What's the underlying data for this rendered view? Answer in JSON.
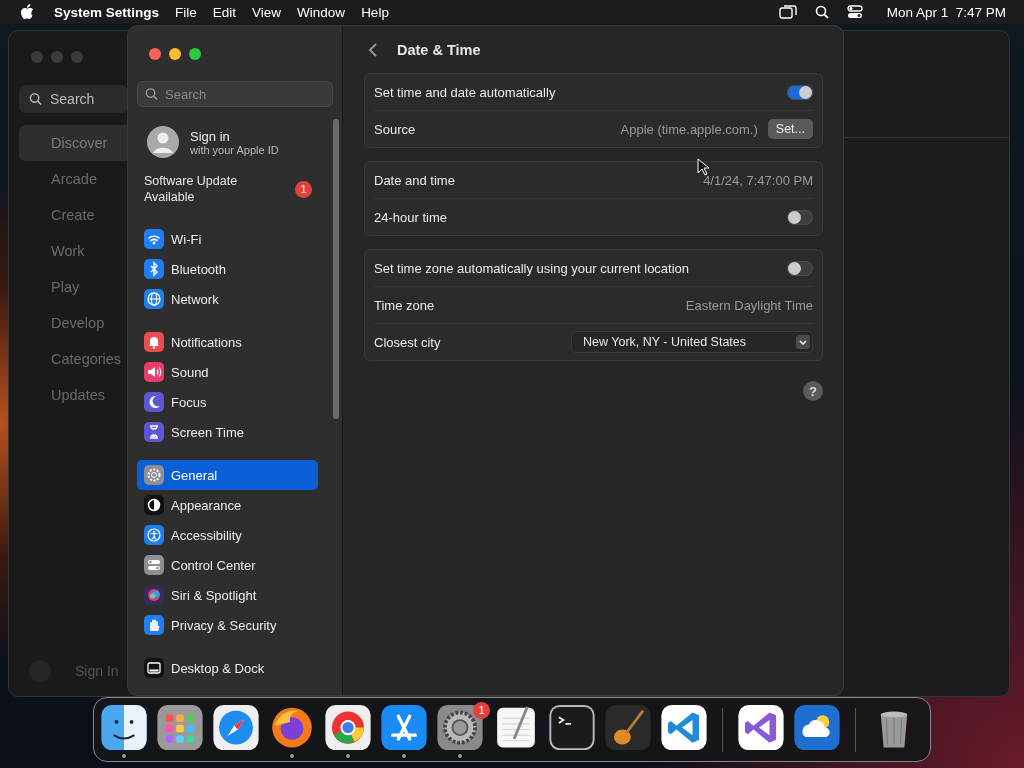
{
  "menubar": {
    "app_name": "System Settings",
    "menus": [
      "File",
      "Edit",
      "View",
      "Window",
      "Help"
    ],
    "clock": "Mon Apr 1  7:47 PM"
  },
  "background_window": {
    "search_placeholder": "Search",
    "items": [
      {
        "label": "Discover",
        "selected": true
      },
      {
        "label": "Arcade",
        "selected": false
      },
      {
        "label": "Create",
        "selected": false
      },
      {
        "label": "Work",
        "selected": false
      },
      {
        "label": "Play",
        "selected": false
      },
      {
        "label": "Develop",
        "selected": false
      },
      {
        "label": "Categories",
        "selected": false
      },
      {
        "label": "Updates",
        "selected": false
      }
    ],
    "sign_in": "Sign In"
  },
  "settings": {
    "sidebar": {
      "search_placeholder": "Search",
      "account": {
        "title": "Sign in",
        "subtitle": "with your Apple ID"
      },
      "update": {
        "label": "Software Update Available",
        "badge": "1"
      },
      "groups": [
        [
          {
            "label": "Wi-Fi",
            "kind": "wifi",
            "selected": false
          },
          {
            "label": "Bluetooth",
            "kind": "bluetooth",
            "selected": false
          },
          {
            "label": "Network",
            "kind": "network",
            "selected": false
          }
        ],
        [
          {
            "label": "Notifications",
            "kind": "notifications",
            "selected": false
          },
          {
            "label": "Sound",
            "kind": "sound",
            "selected": false
          },
          {
            "label": "Focus",
            "kind": "focus",
            "selected": false
          },
          {
            "label": "Screen Time",
            "kind": "screentime",
            "selected": false
          }
        ],
        [
          {
            "label": "General",
            "kind": "general",
            "selected": true
          },
          {
            "label": "Appearance",
            "kind": "appearance",
            "selected": false
          },
          {
            "label": "Accessibility",
            "kind": "accessibility",
            "selected": false
          },
          {
            "label": "Control Center",
            "kind": "controlcenter",
            "selected": false
          },
          {
            "label": "Siri & Spotlight",
            "kind": "siri",
            "selected": false
          },
          {
            "label": "Privacy & Security",
            "kind": "privacy",
            "selected": false
          }
        ],
        [
          {
            "label": "Desktop & Dock",
            "kind": "desktop",
            "selected": false
          }
        ]
      ]
    },
    "content": {
      "title": "Date & Time",
      "groups": [
        [
          {
            "kind": "toggle",
            "label": "Set time and date automatically",
            "on": true
          },
          {
            "kind": "button",
            "label": "Source",
            "value": "Apple (time.apple.com.)",
            "button": "Set..."
          }
        ],
        [
          {
            "kind": "value",
            "label": "Date and time",
            "value": "4/1/24, 7:47:00 PM"
          },
          {
            "kind": "toggle",
            "label": "24-hour time",
            "on": false
          }
        ],
        [
          {
            "kind": "toggle",
            "label": "Set time zone automatically using your current location",
            "on": false
          },
          {
            "kind": "value",
            "label": "Time zone",
            "value": "Eastern Daylight Time"
          },
          {
            "kind": "dropdown",
            "label": "Closest city",
            "value": "New York, NY - United States"
          }
        ]
      ],
      "help": "?"
    }
  },
  "dock": {
    "items": [
      {
        "kind": "finder",
        "running": true
      },
      {
        "kind": "launchpad",
        "running": false
      },
      {
        "kind": "safari",
        "running": false
      },
      {
        "kind": "firefox",
        "running": true
      },
      {
        "kind": "chrome",
        "running": true
      },
      {
        "kind": "appstore",
        "running": true
      },
      {
        "kind": "settings",
        "running": true,
        "badge": "1"
      },
      {
        "kind": "textedit",
        "running": false
      },
      {
        "kind": "terminal",
        "running": false
      },
      {
        "kind": "garageband",
        "running": false
      },
      {
        "kind": "vscode",
        "running": false
      },
      {
        "kind": "separator"
      },
      {
        "kind": "visualstudio",
        "running": false
      },
      {
        "kind": "weather",
        "running": false
      },
      {
        "kind": "separator"
      },
      {
        "kind": "trash",
        "running": false
      }
    ]
  }
}
